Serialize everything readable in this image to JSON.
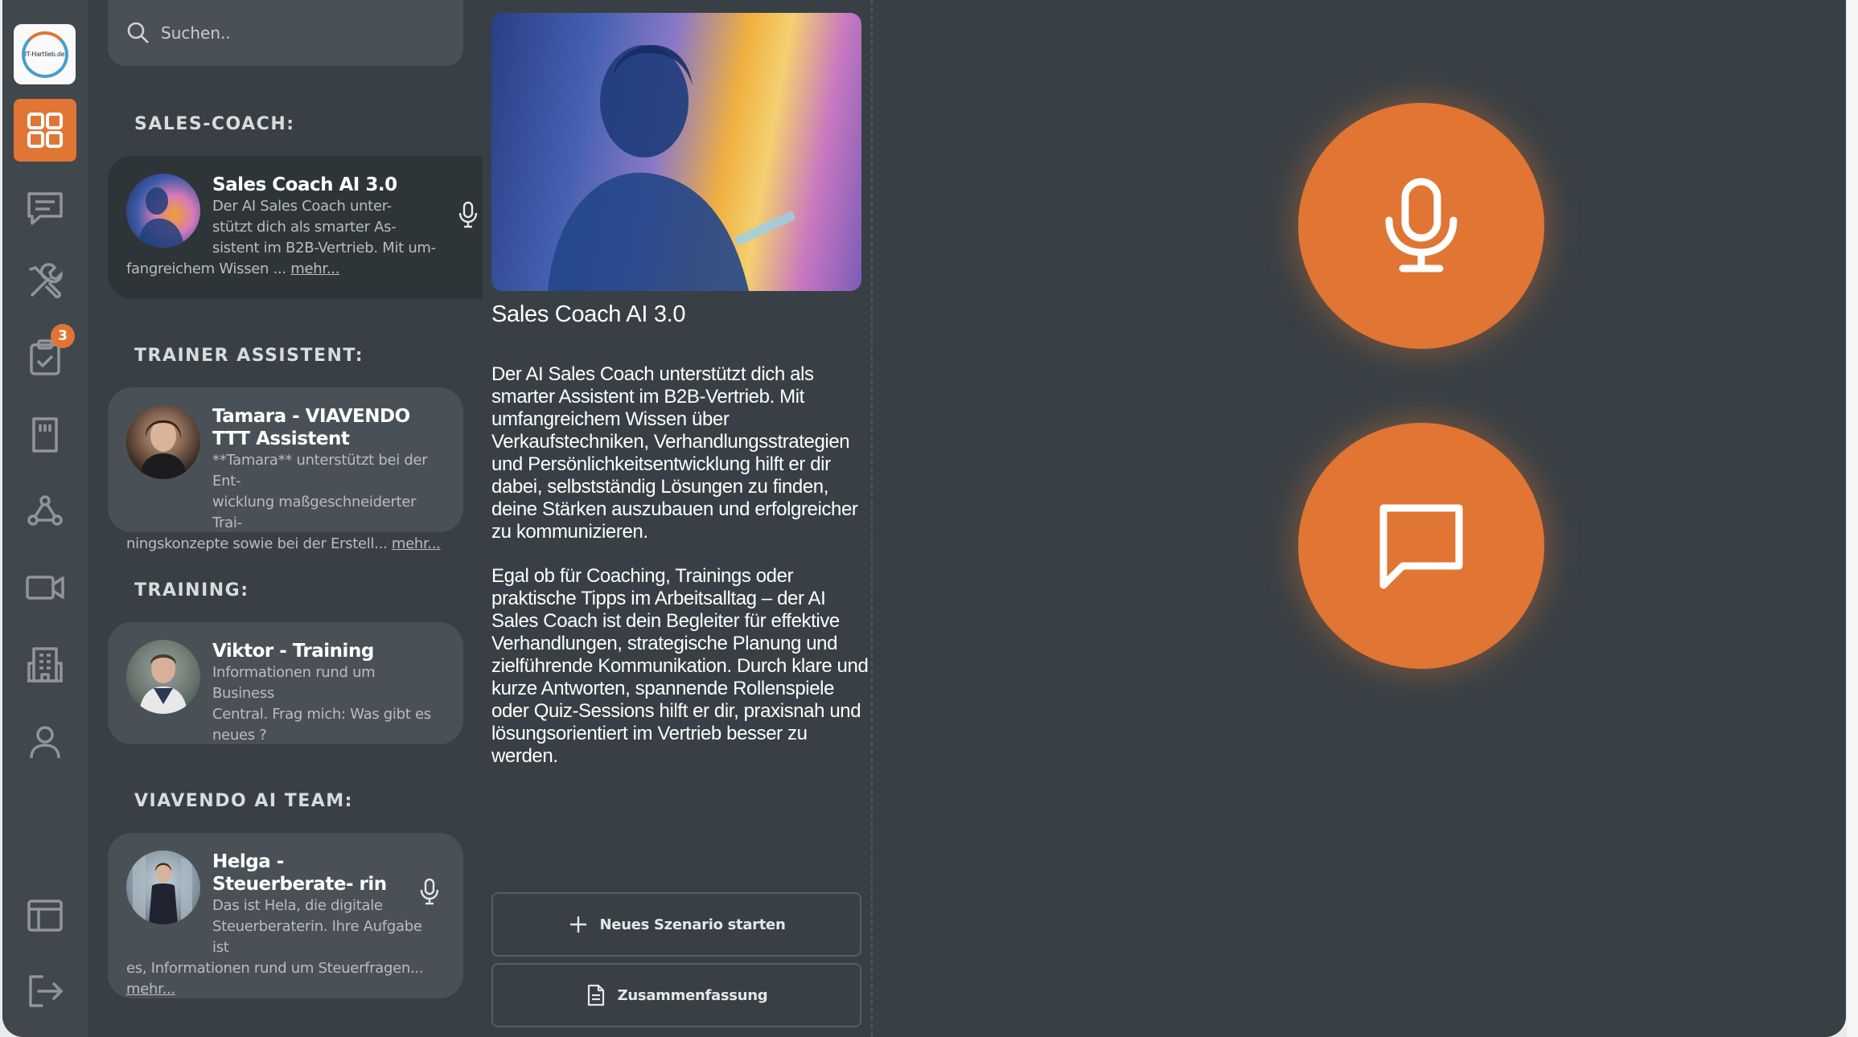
{
  "search": {
    "placeholder": "Suchen.."
  },
  "logo": {
    "text": "IT-Hartlieb.de"
  },
  "rail": {
    "tasks_badge": "3"
  },
  "sections": {
    "sales": "SALES-COACH:",
    "trainer": "TRAINER ASSISTENT:",
    "training": "TRAINING:",
    "team": "VIAVENDO AI TEAM:"
  },
  "cards": [
    {
      "title": "Sales Coach AI 3.0",
      "line1": "Der AI Sales Coach unter-",
      "line2": "stützt dich als smarter As-",
      "line3": "sistent im B2B-Vertrieb. Mit um-",
      "line4": "fangreichem Wissen ...",
      "more": "mehr..."
    },
    {
      "title": "Tamara - VIAVENDO TTT Assistent",
      "line1": "**Tamara** unterstützt bei der Ent-",
      "line2": "wicklung maßgeschneiderter Trai-",
      "line3": "ningskonzepte sowie bei der Erstell...",
      "more": "mehr..."
    },
    {
      "title": "Viktor - Training",
      "line1": "Informationen rund um Business",
      "line2": "Central. Frag mich: Was gibt es",
      "line3": "neues ?"
    },
    {
      "title": "Helga - Steuerberate- rin",
      "line1": "Das ist Hela, die digitale",
      "line2": "Steuerberaterin. Ihre Aufgabe ist",
      "line3": "es, Informationen rund um Steuerfragen...",
      "more": "mehr..."
    }
  ],
  "detail": {
    "title": "Sales Coach AI 3.0",
    "p1": "Der AI Sales Coach unterstützt dich als smarter Assistent im B2B-Vertrieb. Mit umfangreichem Wissen über Verkaufstechniken, Verhandlungsstrategien und Persönlichkeitsentwicklung hilft er dir dabei, selbstständig Lösungen zu finden, deine Stärken auszubauen und erfolgreicher zu kommunizieren.",
    "p2": "Egal ob für Coaching, Trainings oder praktische Tipps im Arbeitsalltag – der AI Sales Coach ist dein Begleiter für effektive Verhandlungen, strategische Planung und zielführende Kommunikation. Durch klare und kurze Antworten, spannende Rollenspiele oder Quiz-Sessions hilft er dir, praxisnah und lösungsorientiert im Vertrieb besser zu werden.",
    "new_scenario": "Neues Szenario starten",
    "summary": "Zusammenfassung"
  },
  "colors": {
    "accent": "#e07534",
    "panel": "#394045",
    "rail": "#40474d",
    "card": "#4a5156"
  }
}
